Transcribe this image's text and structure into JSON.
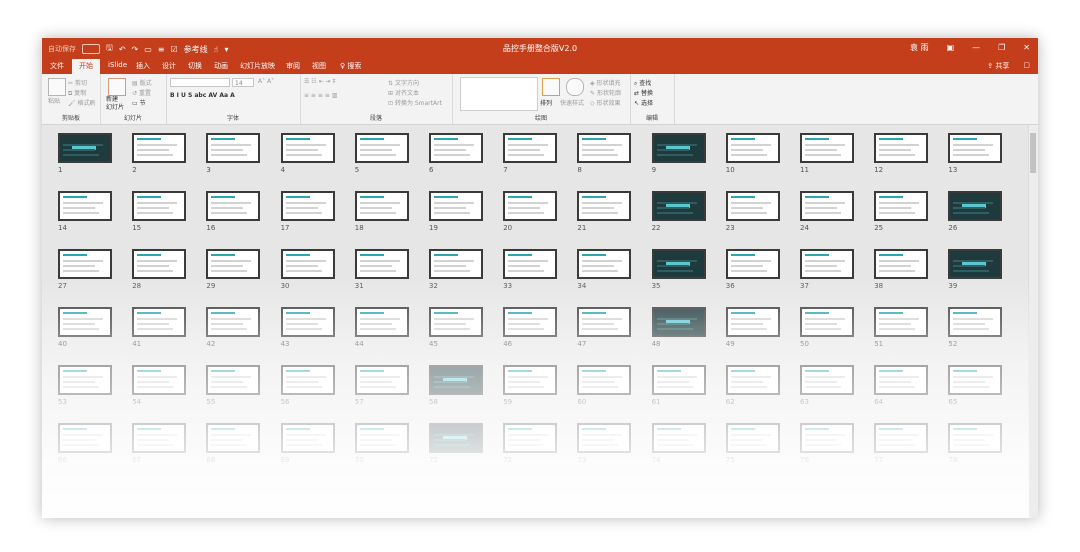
{
  "titlebar": {
    "autosave_label": "自动保存",
    "doc_title": "品控手册整合版V2.0",
    "user": "袁 雨",
    "reference_line": "参考线"
  },
  "tabs": [
    "文件",
    "开始",
    "iSlide",
    "插入",
    "设计",
    "切换",
    "动画",
    "幻灯片放映",
    "审阅",
    "视图"
  ],
  "search_label": "搜索",
  "share_label": "共享",
  "ribbon": {
    "clipboard": {
      "label": "剪贴板",
      "paste": "粘贴",
      "cut": "剪切",
      "copy": "复制",
      "format_painter": "格式刷"
    },
    "slides": {
      "label": "幻灯片",
      "new_slide": "新建\n幻灯片",
      "layout": "版式",
      "reset": "重置",
      "section": "节"
    },
    "font": {
      "label": "字体",
      "size": "14"
    },
    "paragraph": {
      "label": "段落",
      "text_direction": "文字方向",
      "align_text": "对齐文本",
      "smartart": "转换为 SmartArt"
    },
    "drawing": {
      "label": "绘图",
      "arrange": "排列",
      "quick_styles": "快速样式",
      "shape_fill": "形状填充",
      "shape_outline": "形状轮廓",
      "shape_effects": "形状效果"
    },
    "editing": {
      "label": "编辑",
      "find": "查找",
      "replace": "替换",
      "select": "选择"
    }
  },
  "slides": {
    "dark_numbers": [
      1,
      9,
      22,
      26,
      35,
      39,
      48,
      58,
      71
    ],
    "count": 78
  }
}
